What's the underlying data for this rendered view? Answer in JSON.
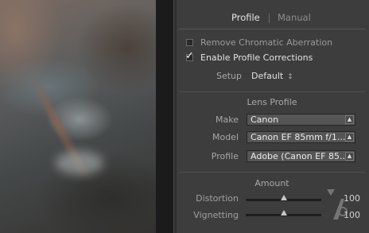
{
  "tabs": {
    "profile": "Profile",
    "manual": "Manual"
  },
  "options": {
    "remove_ca": {
      "label": "Remove Chromatic Aberration",
      "checked": false
    },
    "enable_profile": {
      "label": "Enable Profile Corrections",
      "checked": true
    }
  },
  "setup": {
    "label": "Setup",
    "value": "Default",
    "arrows": "↕"
  },
  "lens_profile": {
    "title": "Lens Profile",
    "make": {
      "label": "Make",
      "value": "Canon"
    },
    "model": {
      "label": "Model",
      "value": "Canon EF 85mm f/1...."
    },
    "profile": {
      "label": "Profile",
      "value": "Adobe (Canon EF 85..."
    }
  },
  "amount": {
    "title": "Amount",
    "distortion": {
      "label": "Distortion",
      "value": "100",
      "level": 0.5
    },
    "vignetting": {
      "label": "Vignetting",
      "value": "100",
      "level": 0.5
    }
  },
  "icons": {
    "check": "checkmark-icon",
    "select_arrows": "up-down-arrows-icon"
  }
}
